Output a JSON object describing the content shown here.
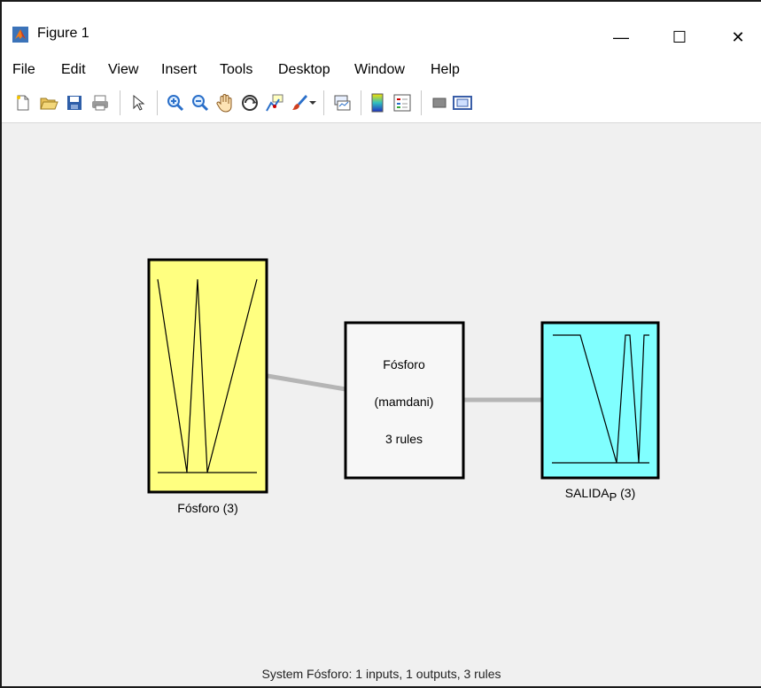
{
  "window": {
    "title": "Figure 1",
    "controls": {
      "minimize": "—",
      "maximize": "☐",
      "close": "✕"
    }
  },
  "menu": {
    "items": [
      "File",
      "Edit",
      "View",
      "Insert",
      "Tools",
      "Desktop",
      "Window",
      "Help"
    ]
  },
  "toolbar": {
    "icons": [
      "new-figure-icon",
      "open-file-icon",
      "save-icon",
      "print-icon",
      "pointer-icon",
      "zoom-in-icon",
      "zoom-out-icon",
      "pan-hand-icon",
      "rotate-3d-icon",
      "data-cursor-icon",
      "brush-icon",
      "link-plot-icon",
      "colorbar-icon",
      "legend-icon",
      "hide-plot-tools-icon",
      "show-plot-tools-icon"
    ]
  },
  "diagram": {
    "input": {
      "name": "Fósforo",
      "mf_count": "(3)",
      "label": "Fósforo (3)",
      "color": "#ffff80"
    },
    "system": {
      "name": "Fósforo",
      "type": "(mamdani)",
      "rules": "3 rules"
    },
    "output": {
      "name": "SALIDA",
      "subscript": "P",
      "mf_count": "(3)",
      "color": "#80ffff"
    }
  },
  "status": "System Fósforo: 1 inputs, 1 outputs, 3 rules"
}
